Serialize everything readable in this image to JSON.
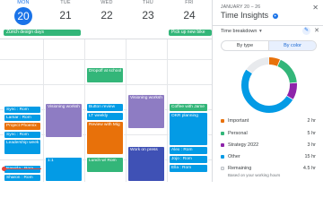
{
  "days": [
    {
      "dow": "MON",
      "num": "20",
      "today": true
    },
    {
      "dow": "TUE",
      "num": "21",
      "today": false
    },
    {
      "dow": "WED",
      "num": "22",
      "today": false
    },
    {
      "dow": "THU",
      "num": "23",
      "today": false
    },
    {
      "dow": "FRI",
      "num": "24",
      "today": false
    }
  ],
  "allday": [
    {
      "label": "Zürich design days"
    },
    {
      "label": "Pick up new bike"
    }
  ],
  "events": [
    {
      "label": "Sync : Rom"
    },
    {
      "label": "Lamar : Rom"
    },
    {
      "label": "Project Phoenix"
    },
    {
      "label": "Sync : Rom"
    },
    {
      "label": "Leadership week"
    },
    {
      "label": "Nawida : Rom"
    },
    {
      "label": "Sharon : Rom"
    },
    {
      "label": "Visioning worksh"
    },
    {
      "label": "1:1"
    },
    {
      "label": "Dropoff at school"
    },
    {
      "label": "Button review"
    },
    {
      "label": "LT weekly"
    },
    {
      "label": "Review with Mig"
    },
    {
      "label": "Lunch w/ Rom"
    },
    {
      "label": "Visioning worksh"
    },
    {
      "label": "Work on press"
    },
    {
      "label": "Coffee with Jame"
    },
    {
      "label": "OKR planning"
    },
    {
      "label": "Alex : Rom"
    },
    {
      "label": "Jojo : Rom"
    },
    {
      "label": "Ella : Rom"
    }
  ],
  "panel": {
    "date_range": "JANUARY 20 – 26",
    "title": "Time Insights",
    "subtitle": "Time breakdown",
    "toggle": [
      "By type",
      "By color"
    ],
    "legend": [
      {
        "label": "Important",
        "value": "2 hr",
        "color": "#e8710a"
      },
      {
        "label": "Personal",
        "value": "5 hr",
        "color": "#33b679"
      },
      {
        "label": "Strategy 2022",
        "value": "3 hr",
        "color": "#8e24aa"
      },
      {
        "label": "Other",
        "value": "15 hr",
        "color": "#039be5"
      },
      {
        "label": "Remaining",
        "value": "4.5 hr",
        "color": "#e8eaed"
      }
    ],
    "note": "Based on your working hours"
  },
  "colors": {
    "accent": "#1a73e8",
    "blue_event": "#039be5",
    "green_event": "#33b679",
    "orange_event": "#e8710a",
    "purple_event": "#8e7cc3",
    "navy_event": "#3f51b5",
    "red_event": "#d50000"
  }
}
